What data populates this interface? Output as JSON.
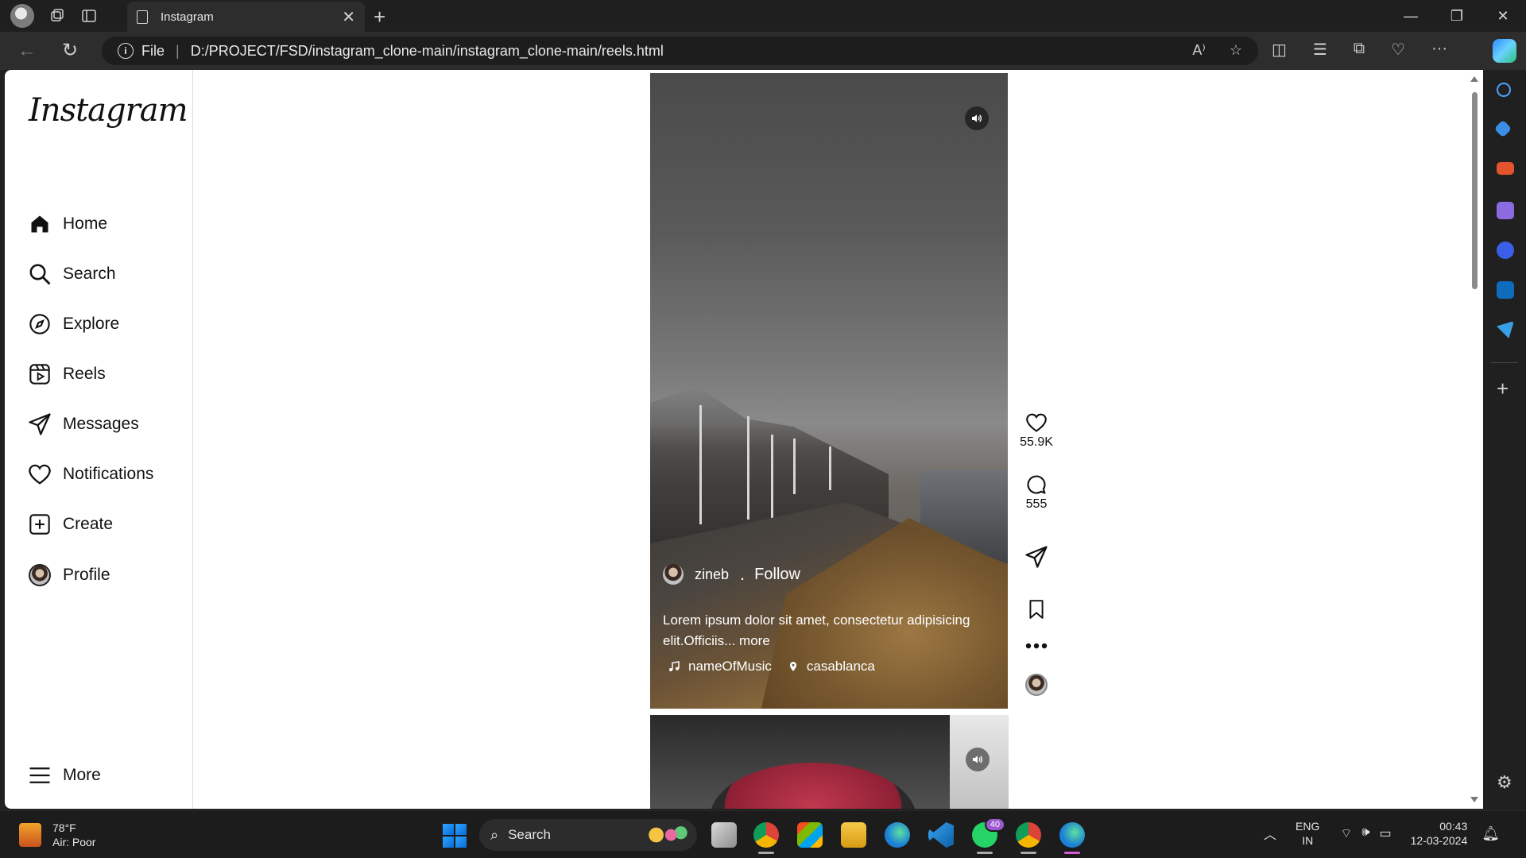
{
  "browser": {
    "tab_title": "Instagram",
    "address_scheme": "File",
    "address_url": "D:/PROJECT/FSD/instagram_clone-main/instagram_clone-main/reels.html"
  },
  "instagram": {
    "logo": "Instagram",
    "nav": [
      {
        "label": "Home",
        "icon": "home-icon"
      },
      {
        "label": "Search",
        "icon": "search-icon"
      },
      {
        "label": "Explore",
        "icon": "compass-icon"
      },
      {
        "label": "Reels",
        "icon": "reels-icon"
      },
      {
        "label": "Messages",
        "icon": "send-icon"
      },
      {
        "label": "Notifications",
        "icon": "heart-icon"
      },
      {
        "label": "Create",
        "icon": "plus-square-icon"
      },
      {
        "label": "Profile",
        "icon": "avatar"
      }
    ],
    "more_label": "More"
  },
  "reel": {
    "username": "zineb",
    "separator": ".",
    "follow_label": "Follow",
    "caption": "Lorem ipsum dolor sit amet, consectetur adipisicing elit.Officiis... more",
    "music": "nameOfMusic",
    "location": "casablanca",
    "likes": "55.9K",
    "comments": "555"
  },
  "taskbar": {
    "weather_temp": "78°F",
    "weather_desc": "Air: Poor",
    "search_label": "Search",
    "whatsapp_badge": "40",
    "lang_top": "ENG",
    "lang_bottom": "IN",
    "time": "00:43",
    "date": "12-03-2024"
  }
}
